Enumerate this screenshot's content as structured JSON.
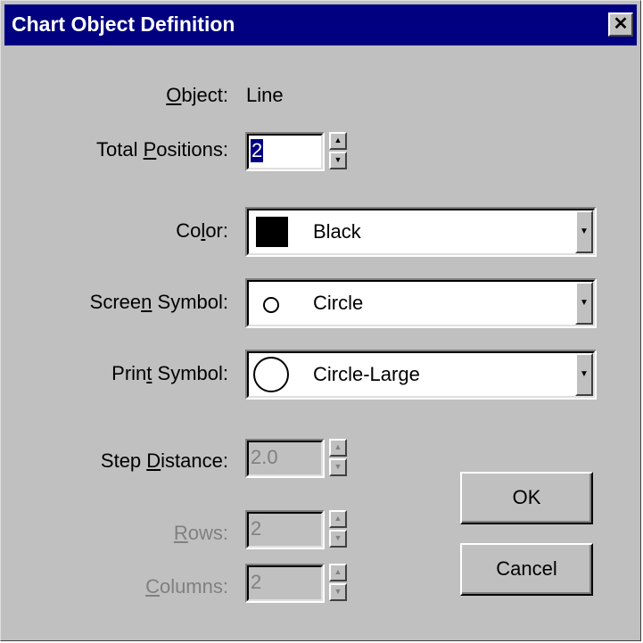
{
  "window": {
    "title": "Chart Object Definition",
    "close_glyph": "✕"
  },
  "fields": {
    "object_label_u": "O",
    "object_label_rest": "bject:",
    "object_value": "Line",
    "total_positions_label_a": "Total ",
    "total_positions_label_u": "P",
    "total_positions_label_b": "ositions:",
    "total_positions_value": "2",
    "color_label_a": "Co",
    "color_label_u": "l",
    "color_label_b": "or:",
    "color_value": "Black",
    "screen_symbol_label_a": "Scree",
    "screen_symbol_label_u": "n",
    "screen_symbol_label_b": " Symbol:",
    "screen_symbol_value": "Circle",
    "print_symbol_label_a": "Prin",
    "print_symbol_label_u": "t",
    "print_symbol_label_b": " Symbol:",
    "print_symbol_value": "Circle-Large",
    "step_distance_label_a": "Step ",
    "step_distance_label_u": "D",
    "step_distance_label_b": "istance:",
    "step_distance_value": "2.0",
    "rows_label_u": "R",
    "rows_label_b": "ows:",
    "rows_value": "2",
    "columns_label_u": "C",
    "columns_label_b": "olumns:",
    "columns_value": "2"
  },
  "buttons": {
    "ok": "OK",
    "cancel": "Cancel"
  },
  "glyphs": {
    "spin_up": "▲",
    "spin_down": "▼",
    "dropdown": "▼"
  },
  "colors": {
    "titlebar": "#000080",
    "face": "#c0c0c0",
    "disabled_text": "#808080"
  }
}
